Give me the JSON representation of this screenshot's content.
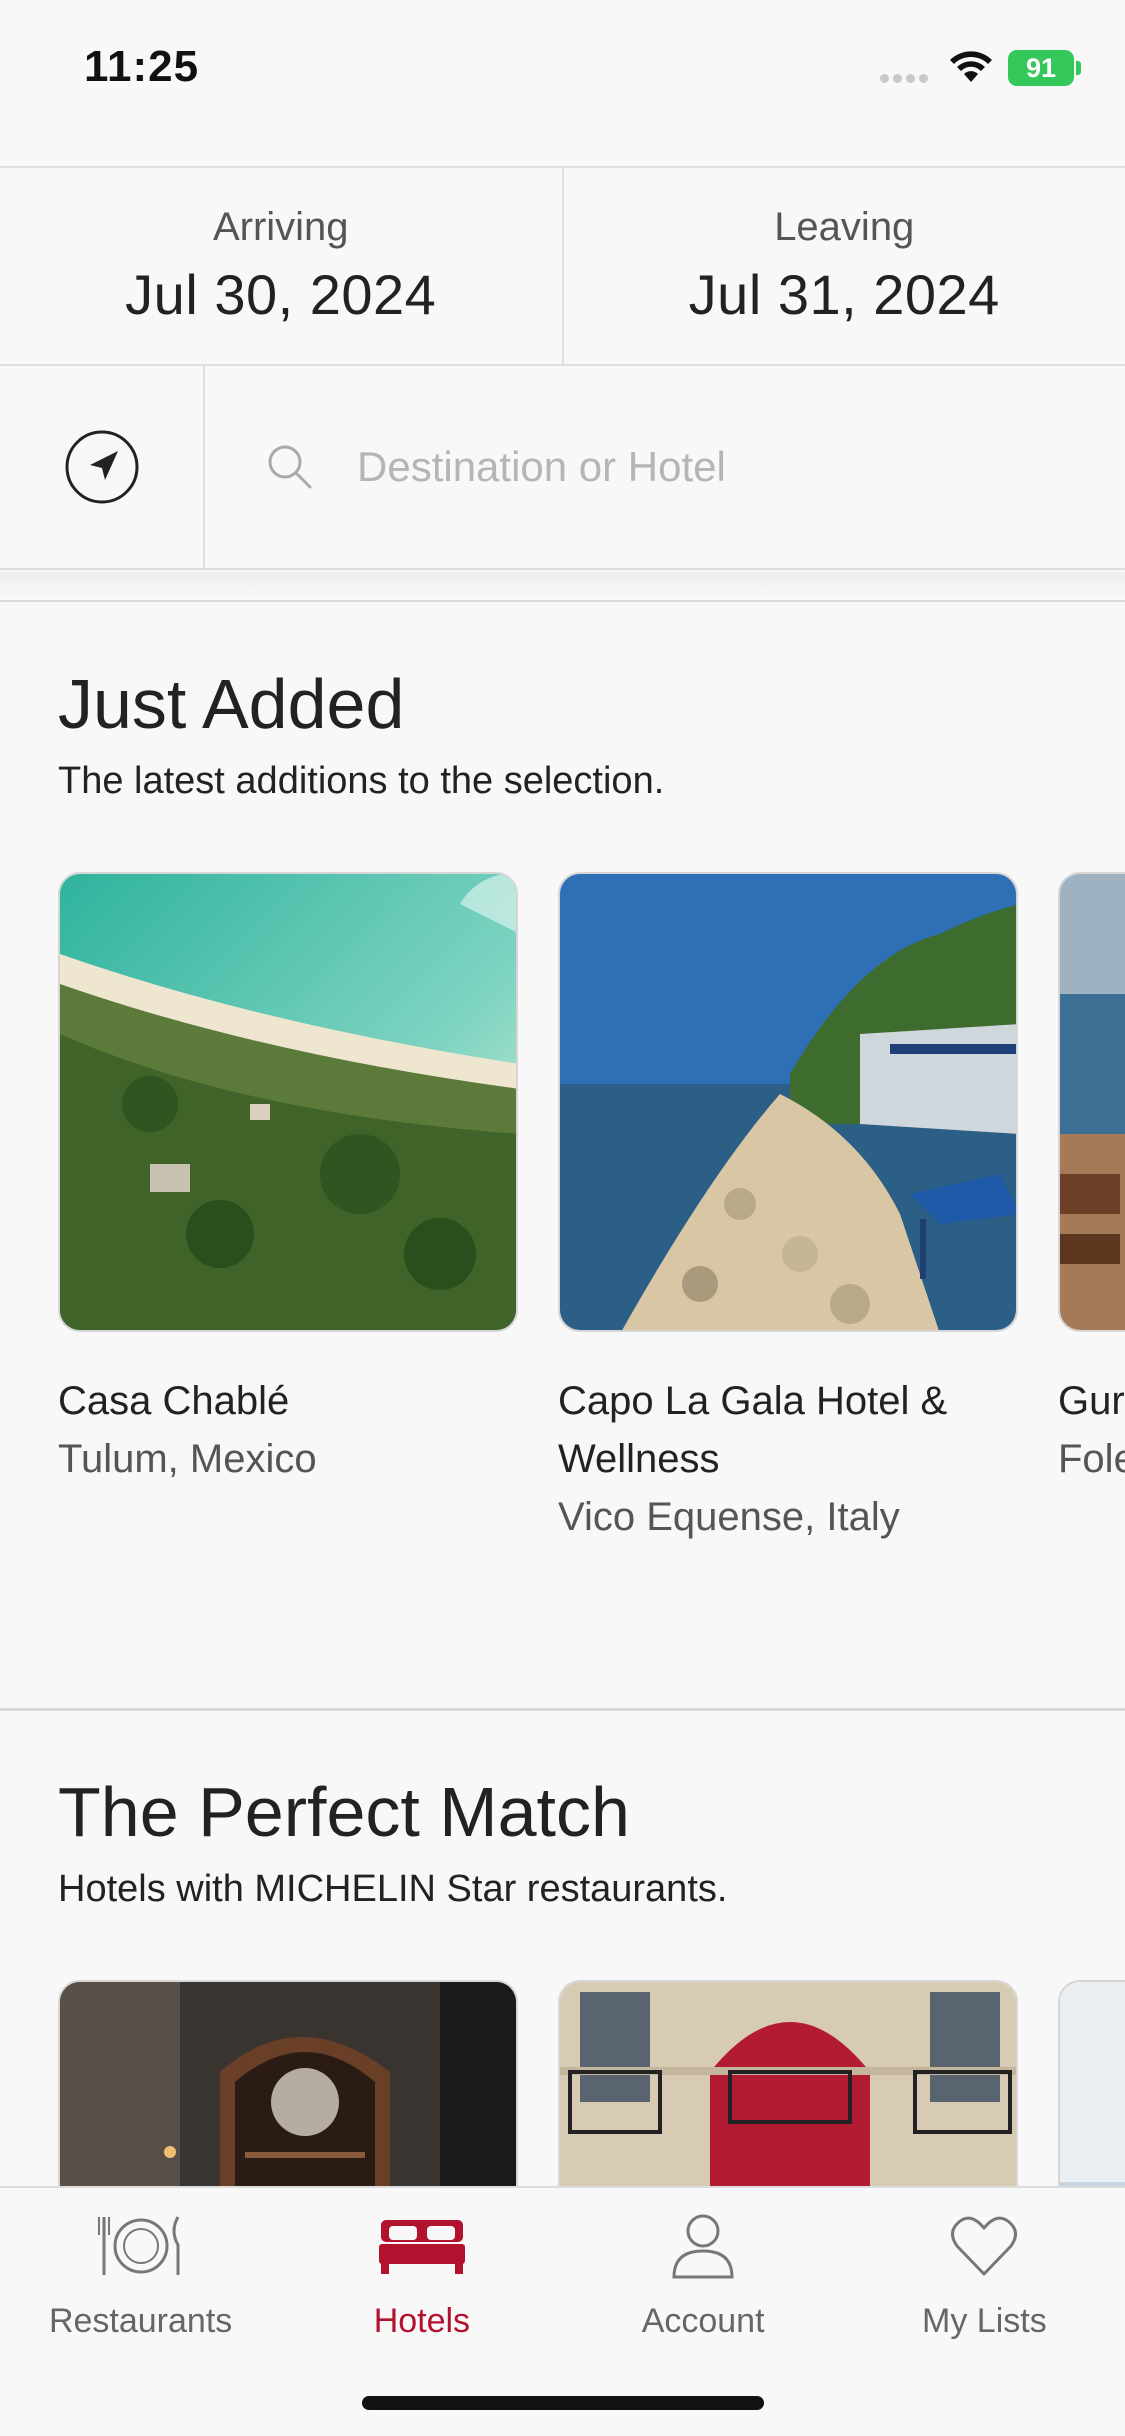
{
  "status": {
    "time": "11:25",
    "battery": "91"
  },
  "dates": {
    "arriving_label": "Arriving",
    "arriving_value": "Jul 30, 2024",
    "leaving_label": "Leaving",
    "leaving_value": "Jul 31, 2024"
  },
  "search": {
    "placeholder": "Destination or Hotel",
    "value": ""
  },
  "just_added": {
    "title": "Just Added",
    "subtitle": "The latest additions to the selection.",
    "cards": [
      {
        "name": "Casa Chablé",
        "location": "Tulum, Mexico"
      },
      {
        "name": "Capo La Gala Hotel & Wellness",
        "location": "Vico Equense, Italy"
      },
      {
        "name": "Gur",
        "location": "Fole"
      }
    ]
  },
  "perfect_match": {
    "title": "The Perfect Match",
    "subtitle": "Hotels with MICHELIN Star restaurants."
  },
  "tabs": [
    {
      "label": "Restaurants",
      "icon": "plate-icon"
    },
    {
      "label": "Hotels",
      "icon": "bed-icon"
    },
    {
      "label": "Account",
      "icon": "person-icon"
    },
    {
      "label": "My Lists",
      "icon": "heart-icon"
    }
  ],
  "colors": {
    "accent": "#b3122e",
    "battery": "#34c759"
  }
}
